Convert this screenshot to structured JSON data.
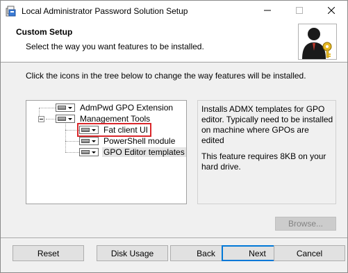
{
  "window": {
    "title": "Local Administrator Password Solution Setup",
    "icons": {
      "app": "installer-icon",
      "minimize": "minimize-icon",
      "maximize": "maximize-icon",
      "close": "close-icon"
    }
  },
  "banner": {
    "title": "Custom Setup",
    "subtitle": "Select the way you want features to be installed.",
    "image": "user-key-icon"
  },
  "instruction": "Click the icons in the tree below to change the way features will be installed.",
  "tree": {
    "items": [
      {
        "label": "AdmPwd GPO Extension",
        "level": 1
      },
      {
        "label": "Management Tools",
        "level": 1,
        "expanded": true
      },
      {
        "label": "Fat client UI",
        "level": 2,
        "selected": true
      },
      {
        "label": "PowerShell module",
        "level": 2
      },
      {
        "label": "GPO Editor templates",
        "level": 2
      }
    ]
  },
  "description": {
    "text": "Installs ADMX templates for GPO editor. Typically need to be installed on machine where GPOs are edited",
    "requirement": "This feature requires 8KB on your hard drive."
  },
  "buttons": {
    "browse": "Browse...",
    "reset": "Reset",
    "disk_usage": "Disk Usage",
    "back": "Back",
    "next": "Next",
    "cancel": "Cancel"
  },
  "colors": {
    "accent": "#0078d7",
    "selection_outline": "#d9262a",
    "disabled_text": "#838383"
  }
}
